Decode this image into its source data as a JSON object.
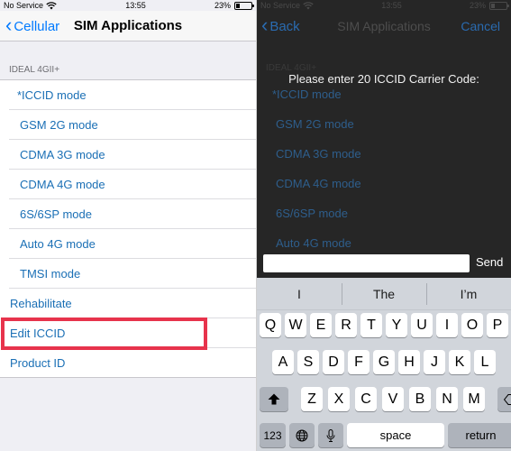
{
  "left": {
    "status_bar": {
      "carrier": "No Service",
      "time": "13:55",
      "battery": "23%",
      "battery_level": 0.23
    },
    "nav": {
      "back_label": "Cellular",
      "title": "SIM Applications"
    },
    "section_header": "IDEAL 4GII+",
    "menu_items": [
      {
        "label": "*ICCID mode"
      },
      {
        "label": "GSM 2G mode"
      },
      {
        "label": "CDMA 3G mode"
      },
      {
        "label": "CDMA 4G mode"
      },
      {
        "label": "6S/6SP mode"
      },
      {
        "label": "Auto 4G mode"
      },
      {
        "label": "TMSI mode"
      }
    ],
    "top_items": [
      {
        "label": "Rehabilitate"
      },
      {
        "label": "Edit ICCID",
        "highlighted": true
      },
      {
        "label": "Product ID"
      }
    ]
  },
  "right": {
    "status_bar": {
      "carrier": "No Service",
      "time": "13:55",
      "battery": "23%",
      "battery_level": 0.23
    },
    "nav": {
      "back_label": "Back",
      "title": "SIM Applications",
      "cancel_label": "Cancel"
    },
    "prompt": "Please enter 20 ICCID Carrier Code:",
    "input": {
      "value": "",
      "placeholder": ""
    },
    "send_label": "Send",
    "keyboard": {
      "suggestions": [
        "I",
        "The",
        "I’m"
      ],
      "row1": [
        "Q",
        "W",
        "E",
        "R",
        "T",
        "Y",
        "U",
        "I",
        "O",
        "P"
      ],
      "row2": [
        "A",
        "S",
        "D",
        "F",
        "G",
        "H",
        "J",
        "K",
        "L"
      ],
      "row3": [
        "Z",
        "X",
        "C",
        "V",
        "B",
        "N",
        "M"
      ],
      "numbers_key": "123",
      "space_key": "space",
      "return_key": "return"
    }
  },
  "colors": {
    "link_blue": "#1a6fb5",
    "ios_blue": "#007aff",
    "highlight_red": "#e7334c",
    "keyboard_bg": "#d1d5db"
  }
}
